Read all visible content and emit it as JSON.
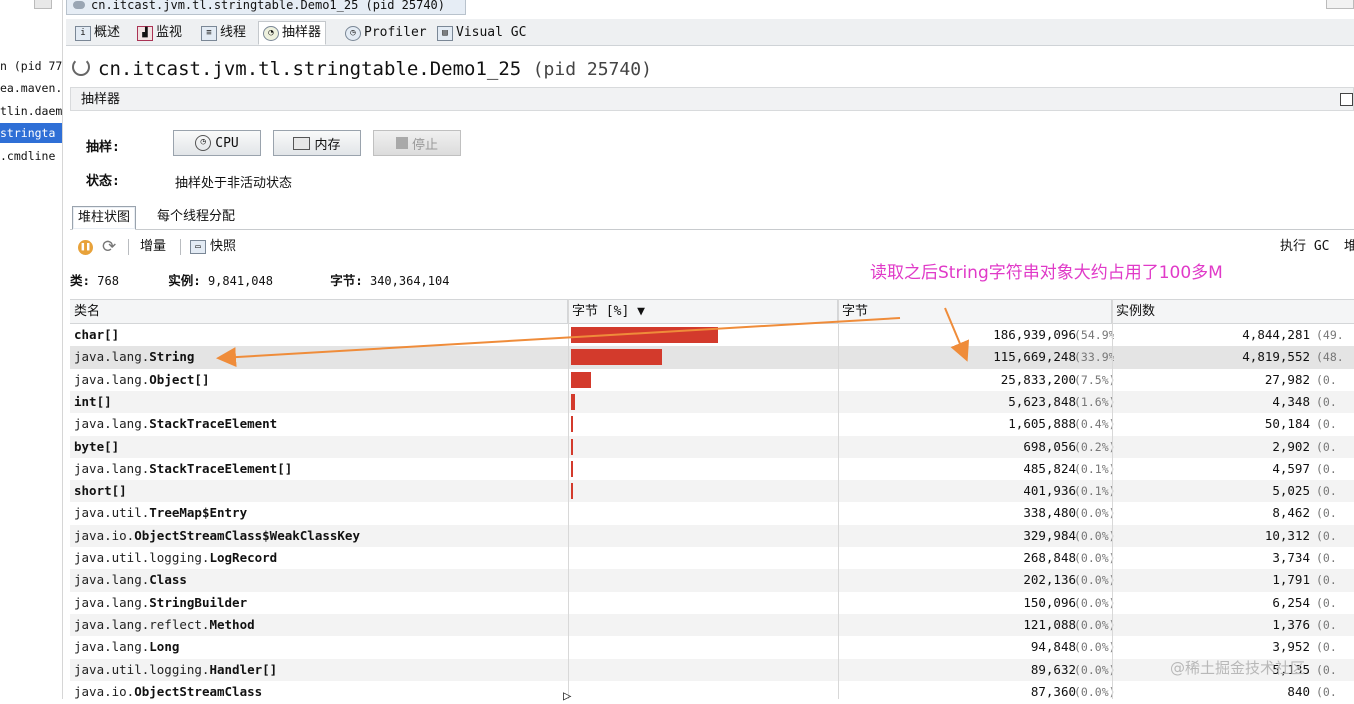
{
  "left_panel": {
    "items": [
      "n (pid 77",
      "ea.maven.",
      "tlin.daem",
      "stringta",
      ".cmdline"
    ],
    "selected_index": 3
  },
  "doc_tab": {
    "label": "cn.itcast.jvm.tl.stringtable.Demo1_25 (pid 25740)",
    "close": "×"
  },
  "subtabs": [
    {
      "label": "概述",
      "icon": "info-icon"
    },
    {
      "label": "监视",
      "icon": "monitor-chart-icon"
    },
    {
      "label": "线程",
      "icon": "threads-icon"
    },
    {
      "label": "抽样器",
      "icon": "sampler-icon"
    },
    {
      "label": "Profiler",
      "icon": "profiler-icon"
    },
    {
      "label": "Visual GC",
      "icon": "visual-gc-icon"
    }
  ],
  "active_subtab": 3,
  "title": {
    "name": "cn.itcast.jvm.tl.stringtable.Demo1_25",
    "pid": "(pid 25740)"
  },
  "sampler": {
    "header": "抽样器",
    "sample_label": "抽样:",
    "status_label": "状态:",
    "status_text": "抽样处于非活动状态",
    "cpu_button": "CPU",
    "memory_button": "内存",
    "stop_button": "停止"
  },
  "view_tabs": [
    "堆柱状图",
    "每个线程分配"
  ],
  "toolbar": {
    "delta": "增量",
    "snapshot": "快照",
    "perform_gc": "执行 GC",
    "heap_dump_partial": "堆"
  },
  "stats": {
    "classes_label": "类:",
    "classes": "768",
    "instances_label": "实例:",
    "instances": "9,841,048",
    "bytes_label": "字节:",
    "bytes": "340,364,104"
  },
  "table": {
    "headers": [
      "类名",
      "字节 [%] ▼",
      "字节",
      "实例数"
    ],
    "rows": [
      {
        "pkg": "",
        "cls": "char[]",
        "bytes": "186,939,096",
        "bytes_pct": "(54.9%)",
        "pct": 54.9,
        "instances": "4,844,281",
        "inst_pct": "(49."
      },
      {
        "pkg": "java.lang.",
        "cls": "String",
        "bytes": "115,669,248",
        "bytes_pct": "(33.9%)",
        "pct": 33.9,
        "instances": "4,819,552",
        "inst_pct": "(48."
      },
      {
        "pkg": "java.lang.",
        "cls": "Object[]",
        "bytes": "25,833,200",
        "bytes_pct": "(7.5%)",
        "pct": 7.5,
        "instances": "27,982",
        "inst_pct": "(0."
      },
      {
        "pkg": "",
        "cls": "int[]",
        "bytes": "5,623,848",
        "bytes_pct": "(1.6%)",
        "pct": 1.6,
        "instances": "4,348",
        "inst_pct": "(0."
      },
      {
        "pkg": "java.lang.",
        "cls": "StackTraceElement",
        "bytes": "1,605,888",
        "bytes_pct": "(0.4%)",
        "pct": 0.4,
        "instances": "50,184",
        "inst_pct": "(0."
      },
      {
        "pkg": "",
        "cls": "byte[]",
        "bytes": "698,056",
        "bytes_pct": "(0.2%)",
        "pct": 0.2,
        "instances": "2,902",
        "inst_pct": "(0."
      },
      {
        "pkg": "java.lang.",
        "cls": "StackTraceElement[]",
        "bytes": "485,824",
        "bytes_pct": "(0.1%)",
        "pct": 0.1,
        "instances": "4,597",
        "inst_pct": "(0."
      },
      {
        "pkg": "",
        "cls": "short[]",
        "bytes": "401,936",
        "bytes_pct": "(0.1%)",
        "pct": 0.1,
        "instances": "5,025",
        "inst_pct": "(0."
      },
      {
        "pkg": "java.util.",
        "cls": "TreeMap$Entry",
        "bytes": "338,480",
        "bytes_pct": "(0.0%)",
        "pct": 0.0,
        "instances": "8,462",
        "inst_pct": "(0."
      },
      {
        "pkg": "java.io.",
        "cls": "ObjectStreamClass$WeakClassKey",
        "bytes": "329,984",
        "bytes_pct": "(0.0%)",
        "pct": 0.0,
        "instances": "10,312",
        "inst_pct": "(0."
      },
      {
        "pkg": "java.util.logging.",
        "cls": "LogRecord",
        "bytes": "268,848",
        "bytes_pct": "(0.0%)",
        "pct": 0.0,
        "instances": "3,734",
        "inst_pct": "(0."
      },
      {
        "pkg": "java.lang.",
        "cls": "Class",
        "bytes": "202,136",
        "bytes_pct": "(0.0%)",
        "pct": 0.0,
        "instances": "1,791",
        "inst_pct": "(0."
      },
      {
        "pkg": "java.lang.",
        "cls": "StringBuilder",
        "bytes": "150,096",
        "bytes_pct": "(0.0%)",
        "pct": 0.0,
        "instances": "6,254",
        "inst_pct": "(0."
      },
      {
        "pkg": "java.lang.reflect.",
        "cls": "Method",
        "bytes": "121,088",
        "bytes_pct": "(0.0%)",
        "pct": 0.0,
        "instances": "1,376",
        "inst_pct": "(0."
      },
      {
        "pkg": "java.lang.",
        "cls": "Long",
        "bytes": "94,848",
        "bytes_pct": "(0.0%)",
        "pct": 0.0,
        "instances": "3,952",
        "inst_pct": "(0."
      },
      {
        "pkg": "java.util.logging.",
        "cls": "Handler[]",
        "bytes": "89,632",
        "bytes_pct": "(0.0%)",
        "pct": 0.0,
        "instances": "5,135",
        "inst_pct": "(0."
      },
      {
        "pkg": "java.io.",
        "cls": "ObjectStreamClass",
        "bytes": "87,360",
        "bytes_pct": "(0.0%)",
        "pct": 0.0,
        "instances": "840",
        "inst_pct": "(0."
      }
    ],
    "selected_row": 1
  },
  "annotation": "读取之后String字符串对象大约占用了100多M",
  "watermark": "@稀土掘金技术社区",
  "colors": {
    "bar": "#d33a2c",
    "annotation": "#e03ac8",
    "arrow": "#ef8c3a",
    "selection": "#2f6fd6"
  }
}
